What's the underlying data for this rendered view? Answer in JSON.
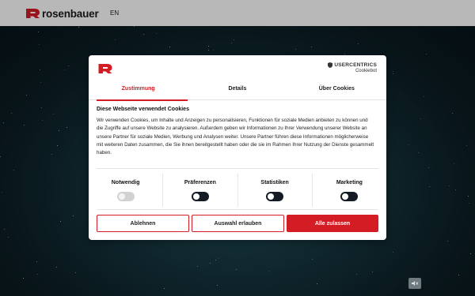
{
  "header": {
    "brand": "rosenbauer",
    "language": "EN"
  },
  "colors": {
    "brand_red": "#d31c24",
    "toggle_on": "#141b24",
    "toggle_disabled": "#d0d2d4"
  },
  "consent": {
    "provider_line1": "USERCENTRICS",
    "provider_line2": "Cookiebot",
    "tabs": [
      {
        "label": "Zustimmung",
        "active": true
      },
      {
        "label": "Details",
        "active": false
      },
      {
        "label": "Über Cookies",
        "active": false
      }
    ],
    "title": "Diese Webseite verwendet Cookies",
    "body": "Wir verwenden Cookies, um Inhalte und Anzeigen zu personalisieren, Funktionen für soziale Medien anbieten zu können und die Zugriffe auf unsere Website zu analysieren. Außerdem geben wir Informationen zu Ihrer Verwendung unserer Website an unsere Partner für soziale Medien, Werbung und Analysen weiter. Unsere Partner führen diese Informationen möglicherweise mit weiteren Daten zusammen, die Sie ihnen bereitgestellt haben oder die sie im Rahmen Ihrer Nutzung der Dienste gesammelt haben.",
    "categories": [
      {
        "label": "Notwendig",
        "enabled": true,
        "disabled": true
      },
      {
        "label": "Präferenzen",
        "enabled": false,
        "disabled": false
      },
      {
        "label": "Statistiken",
        "enabled": false,
        "disabled": false
      },
      {
        "label": "Marketing",
        "enabled": false,
        "disabled": false
      }
    ],
    "buttons": {
      "deny": "Ablehnen",
      "select": "Auswahl erlauben",
      "allow_all": "Alle zulassen"
    }
  },
  "icons": {
    "logo": "rosenbauer-logo-icon",
    "mute": "speaker-mute-icon",
    "shield": "shield-icon"
  }
}
